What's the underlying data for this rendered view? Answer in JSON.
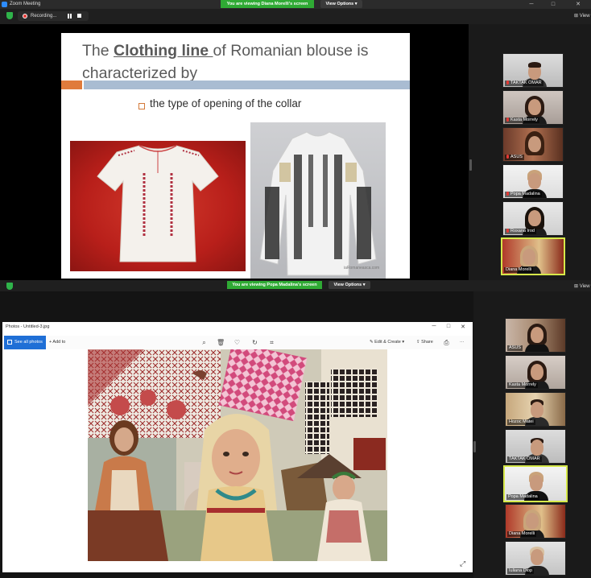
{
  "window": {
    "app_title": "Zoom Meeting",
    "minimize": "─",
    "maximize": "□",
    "close": "✕"
  },
  "top_share": {
    "banner": "You are viewing Diana Morelli's screen",
    "view_options": "View Options ▾",
    "recording_label": "Recording...",
    "view_label": "View",
    "slide": {
      "title_prefix": "The ",
      "title_highlight": "Clothing line ",
      "title_suffix": "of Romanian blouse is characterized by",
      "bullet": "the type of opening of the collar",
      "watermark": "iaRomaneasca.com"
    },
    "participants": [
      {
        "name": "TAKTAK OMAR",
        "muted": true
      },
      {
        "name": "Kasta Morrely",
        "muted": true
      },
      {
        "name": "ASUS",
        "muted": true
      },
      {
        "name": "Popa Madalina",
        "muted": true
      },
      {
        "name": "Roxana Irod",
        "muted": true
      },
      {
        "name": "Diana Morelli",
        "muted": false,
        "active": true
      }
    ]
  },
  "bottom_share": {
    "banner": "You are viewing Popa Madalina's screen",
    "view_options": "View Options ▾",
    "view_label": "View",
    "photos": {
      "title": "Photos - Untitled-3.jpg",
      "see_all": "See all photos",
      "add_to": "+ Add to",
      "edit_create": "Edit & Create ▾",
      "share": "Share",
      "more": "···",
      "minimize": "─",
      "maximize": "□",
      "close": "✕"
    },
    "participants": [
      {
        "name": "ASUS"
      },
      {
        "name": "Kasta Morrely"
      },
      {
        "name": "Hozoc Matei"
      },
      {
        "name": "TAKTAK OMAR"
      },
      {
        "name": "Popa Madalina",
        "active": true
      },
      {
        "name": "Diana Morelli"
      },
      {
        "name": "Iuliana Diop"
      }
    ]
  }
}
